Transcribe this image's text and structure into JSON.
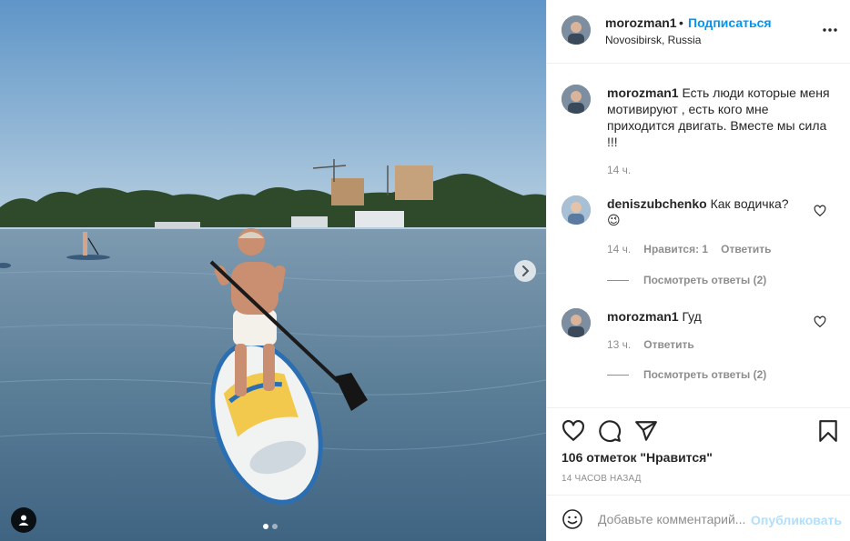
{
  "post": {
    "username": "morozman1",
    "follow_label": "Подписаться",
    "separator": "•",
    "location": "Novosibirsk, Russia"
  },
  "caption": {
    "username": "morozman1",
    "text": "Есть люди которые меня мотивируют , есть кого мне приходится двигать. Вместе мы сила !!!",
    "time": "14 ч."
  },
  "comments": [
    {
      "username": "deniszubchenko",
      "text": "Как водичка?",
      "emoji": "😉",
      "time": "14 ч.",
      "likes_label": "Нравится: 1",
      "reply_label": "Ответить",
      "view_replies": "Посмотреть ответы (2)"
    },
    {
      "username": "morozman1",
      "text": "Гуд",
      "time": "13 ч.",
      "reply_label": "Ответить",
      "view_replies": "Посмотреть ответы (2)"
    }
  ],
  "likes_text": "106 отметок \"Нравится\"",
  "time_ago": "14 ЧАСОВ НАЗАД",
  "add_comment": {
    "placeholder": "Добавьте комментарий...",
    "post_label": "Опубликовать"
  },
  "icons": [
    "more-icon",
    "heart-icon",
    "comment-icon",
    "share-icon",
    "bookmark-icon",
    "emoji-icon",
    "chevron-right-icon",
    "user-tag-icon"
  ],
  "colors": {
    "accent": "#0095f6",
    "post_disabled": "#b2dffc",
    "muted": "#8e8e8e",
    "text": "#262626",
    "border": "#efefef"
  },
  "carousel": {
    "slides": 2,
    "active": 1
  }
}
